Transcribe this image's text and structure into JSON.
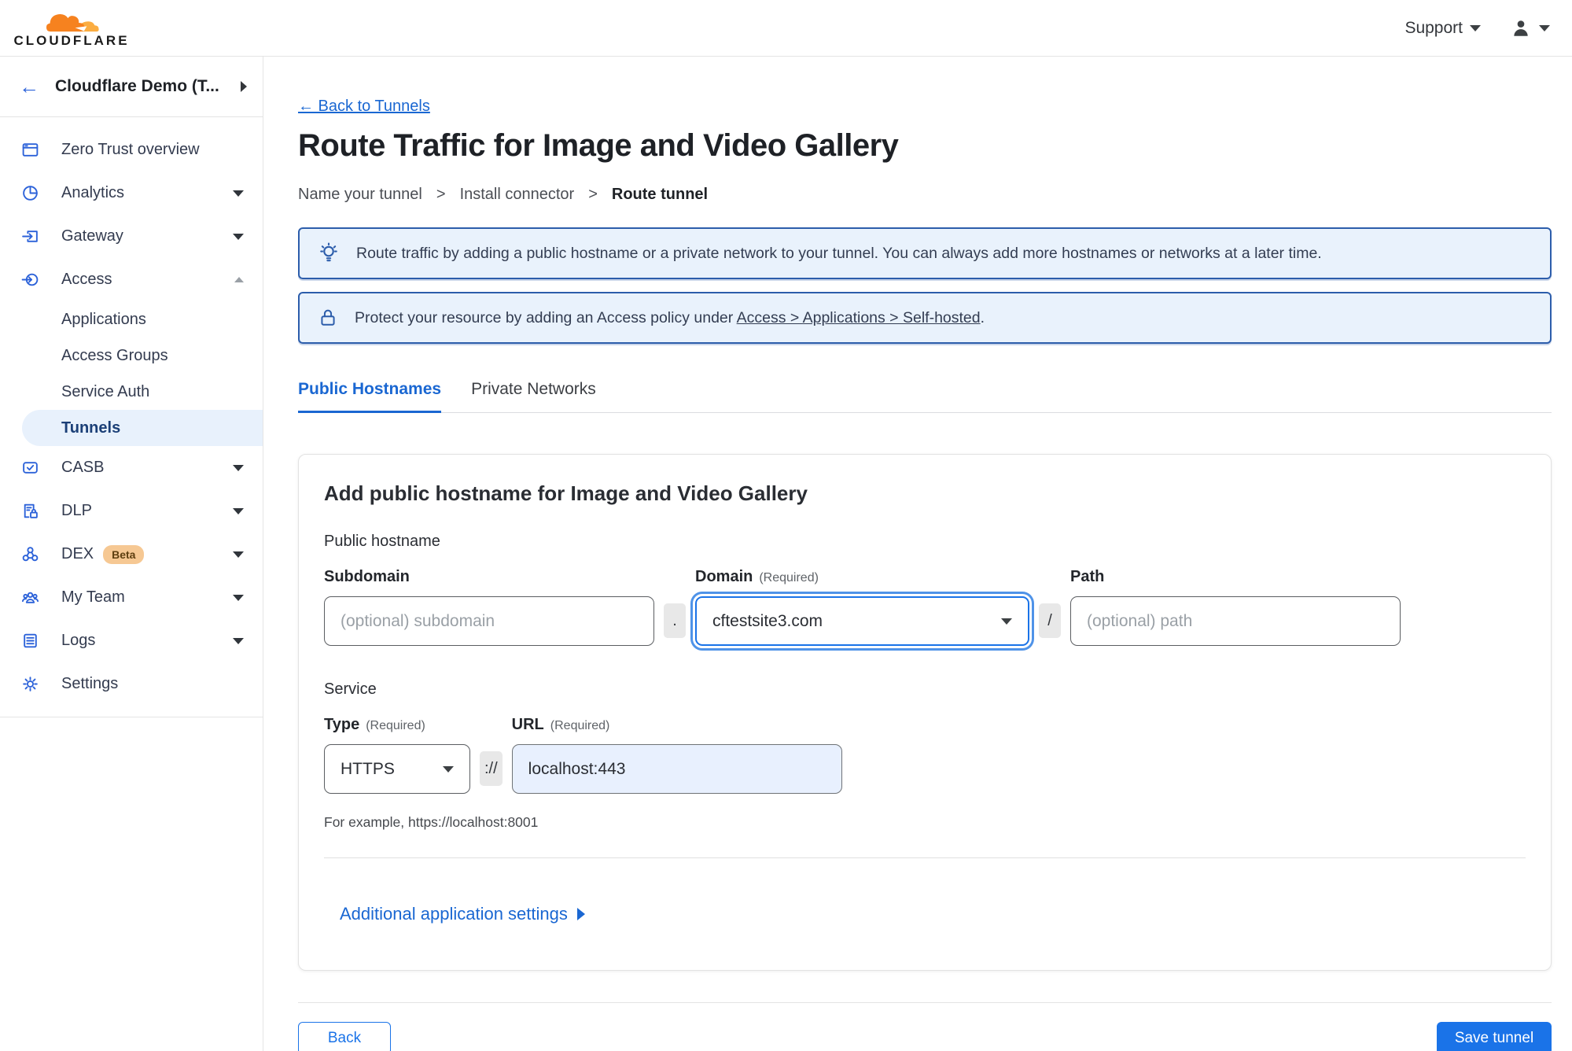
{
  "topbar": {
    "brand": "CLOUDFLARE",
    "support_label": "Support"
  },
  "sidebar": {
    "account": {
      "back_arrow": "←",
      "name": "Cloudflare Demo (T..."
    },
    "items": [
      {
        "label": "Zero Trust overview"
      },
      {
        "label": "Analytics"
      },
      {
        "label": "Gateway"
      },
      {
        "label": "Access"
      },
      {
        "label": "CASB"
      },
      {
        "label": "DLP"
      },
      {
        "label": "DEX",
        "badge": "Beta"
      },
      {
        "label": "My Team"
      },
      {
        "label": "Logs"
      },
      {
        "label": "Settings"
      }
    ],
    "access_subitems": [
      {
        "label": "Applications"
      },
      {
        "label": "Access Groups"
      },
      {
        "label": "Service Auth"
      },
      {
        "label": "Tunnels"
      }
    ]
  },
  "page": {
    "back_link": "← Back to Tunnels",
    "title": "Route Traffic for Image and Video Gallery",
    "breadcrumb": {
      "step1": "Name your tunnel",
      "sep1": ">",
      "step2": "Install connector",
      "sep2": ">",
      "step3": "Route tunnel"
    },
    "banners": {
      "info": "Route traffic by adding a public hostname or a private network to your tunnel. You can always add more hostnames or networks at a later time.",
      "protect_prefix": "Protect your resource by adding an Access policy under ",
      "protect_link": "Access > Applications > Self-hosted",
      "protect_suffix": "."
    },
    "tabs": {
      "public": "Public Hostnames",
      "private": "Private Networks"
    }
  },
  "form": {
    "card_title": "Add public hostname for Image and Video Gallery",
    "public_hostname_label": "Public hostname",
    "subdomain": {
      "label": "Subdomain",
      "placeholder": "(optional) subdomain"
    },
    "dot_separator": ".",
    "domain": {
      "label": "Domain",
      "required": "(Required)",
      "value": "cftestsite3.com"
    },
    "slash_separator": "/",
    "path": {
      "label": "Path",
      "placeholder": "(optional) path"
    },
    "service_label": "Service",
    "type": {
      "label": "Type",
      "required": "(Required)",
      "value": "HTTPS"
    },
    "scheme_separator": "://",
    "url": {
      "label": "URL",
      "required": "(Required)",
      "value": "localhost:443"
    },
    "example_text": "For example, https://localhost:8001",
    "additional_settings": "Additional application settings"
  },
  "actions": {
    "back": "Back",
    "save": "Save tunnel"
  },
  "colors": {
    "accent_blue": "#1a73e8",
    "link_blue": "#1a67d2",
    "banner_border": "#2c5dab",
    "banner_bg": "#e9f2fc",
    "autofill_bg": "#e8f0fe",
    "selected_bg": "#e8f1fc",
    "beta_bg": "#f6c893",
    "brand_orange": "#f6821f",
    "brand_orange_light": "#fbad41"
  }
}
